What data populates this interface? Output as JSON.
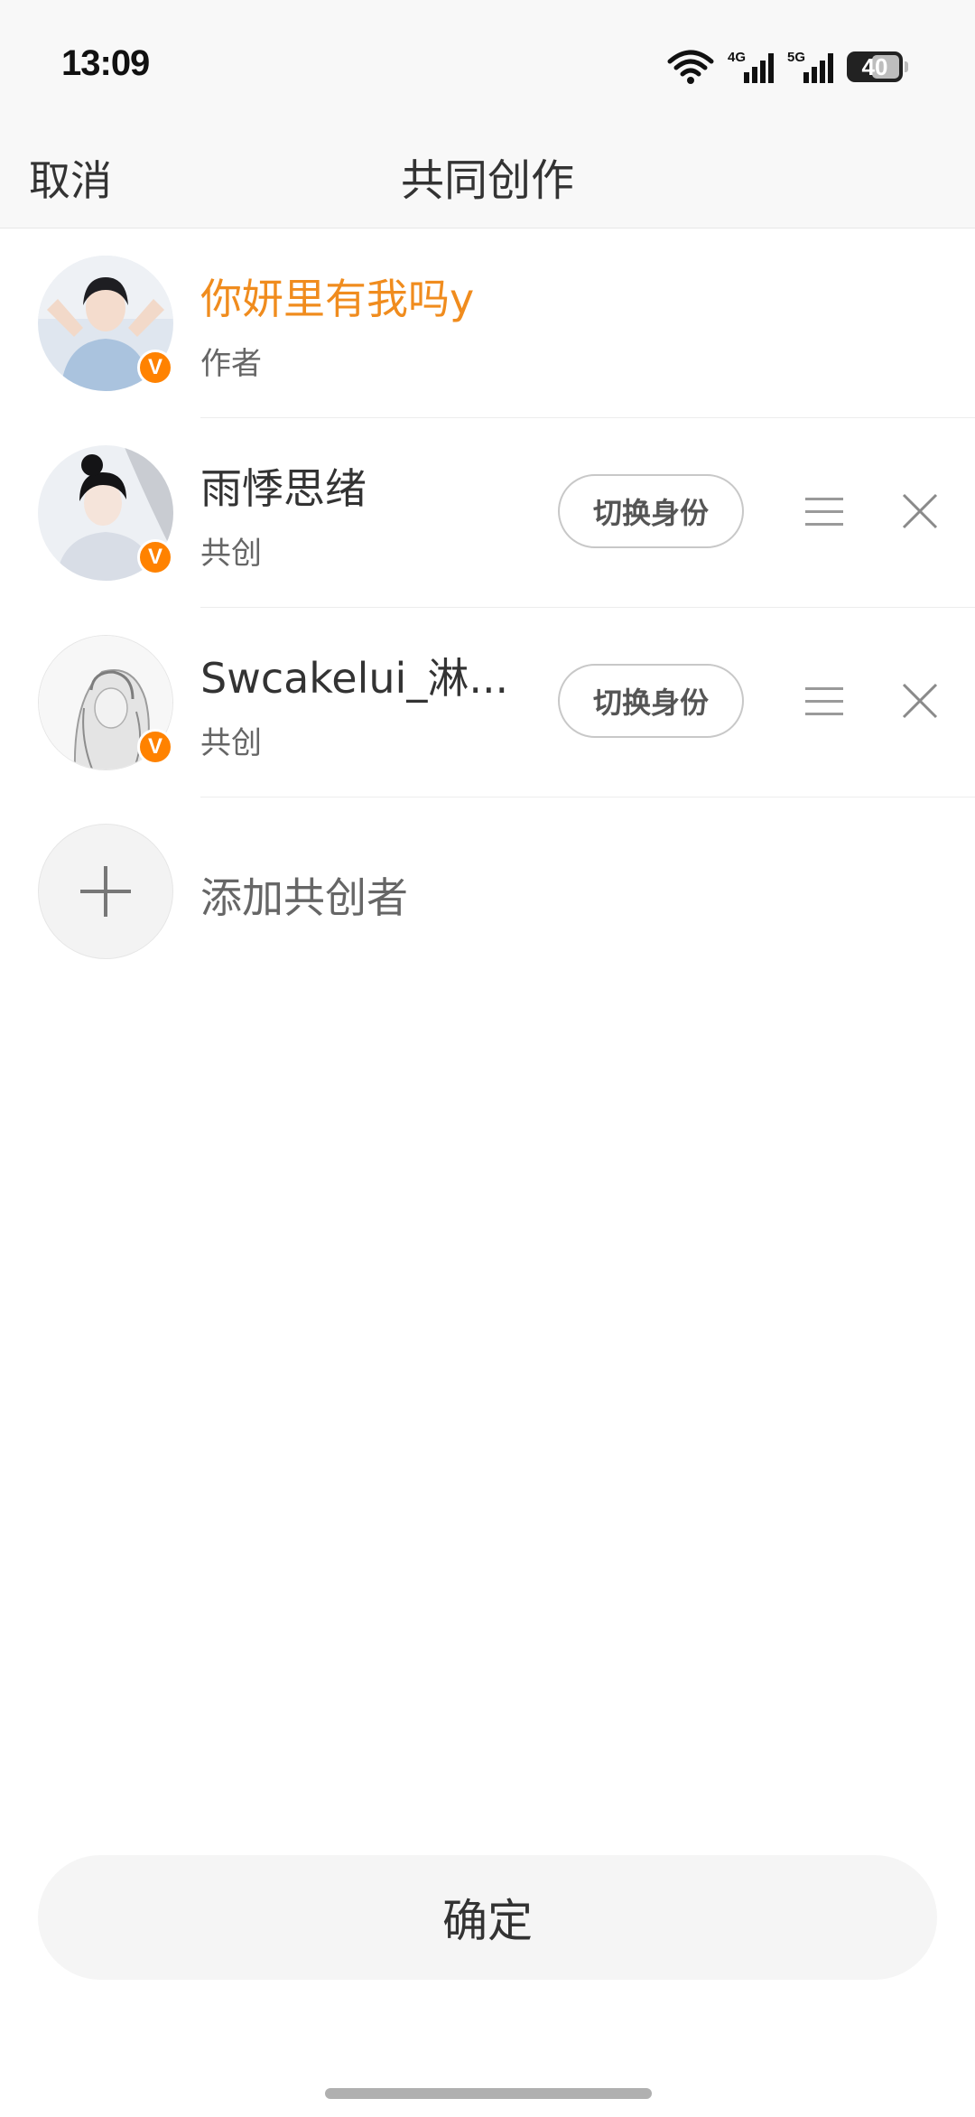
{
  "status_bar": {
    "time": "13:09",
    "network_1": "4G",
    "network_2": "5G",
    "battery": "40"
  },
  "nav": {
    "cancel_label": "取消",
    "title": "共同创作"
  },
  "collaborators": [
    {
      "name": "你妍里有我吗y",
      "role": "作者",
      "verified": true,
      "name_color": "#f08c1e"
    },
    {
      "name": "雨悸思绪",
      "role": "共创",
      "verified": true,
      "switch_label": "切换身份"
    },
    {
      "name": "Swcakelui_淋...",
      "role": "共创",
      "verified": true,
      "switch_label": "切换身份"
    }
  ],
  "verified_badge": "V",
  "add": {
    "label": "添加共创者"
  },
  "confirm_label": "确定",
  "colors": {
    "accent": "#ff8200",
    "author_name": "#f08c1e"
  }
}
